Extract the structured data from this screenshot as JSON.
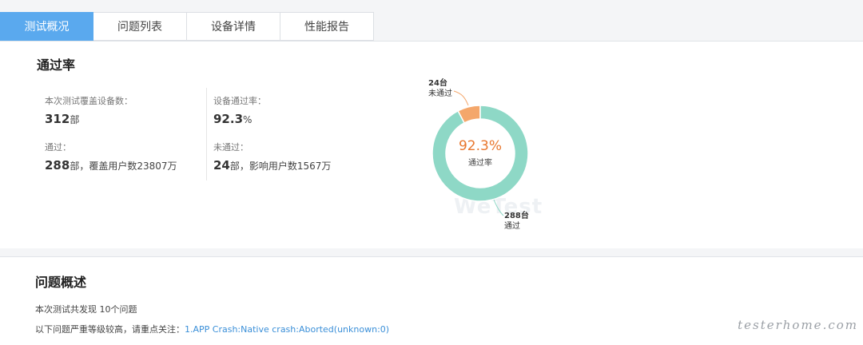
{
  "tabs": [
    "测试概况",
    "问题列表",
    "设备详情",
    "性能报告"
  ],
  "pass_section": {
    "title": "通过率",
    "stats": [
      {
        "label": "本次测试覆盖设备数：",
        "value": "312",
        "unit": "部",
        "extra": ""
      },
      {
        "label": "设备通过率：",
        "value": "92.3",
        "unit": "%",
        "extra": ""
      },
      {
        "label": "通过：",
        "value": "288",
        "unit": "部",
        "extra": "，覆盖用户数23807万"
      },
      {
        "label": "未通过：",
        "value": "24",
        "unit": "部",
        "extra": "，影响用户数1567万"
      }
    ]
  },
  "chart_data": {
    "type": "pie",
    "categories": [
      "未通过",
      "通过"
    ],
    "values": [
      24,
      288
    ],
    "center_value": "92.3%",
    "center_label": "通过率",
    "labels": [
      {
        "count": "24台",
        "name": "未通过"
      },
      {
        "count": "288台",
        "name": "通过"
      }
    ],
    "colors": {
      "未通过": "#f4a76b",
      "通过": "#8ed8c6"
    }
  },
  "watermark": "WeTest",
  "issue_section": {
    "title": "问题概述",
    "summary": "本次测试共发现 10个问题",
    "focus_prefix": "以下问题严重等级较高，请重点关注：",
    "focus_link": "1.APP Crash:Native crash:Aborted(unknown:0)"
  },
  "site_mark": "testerhome.com",
  "colors": {
    "accent": "#5aa9ee",
    "link": "#3a8fd8",
    "pct": "#e8772e"
  }
}
